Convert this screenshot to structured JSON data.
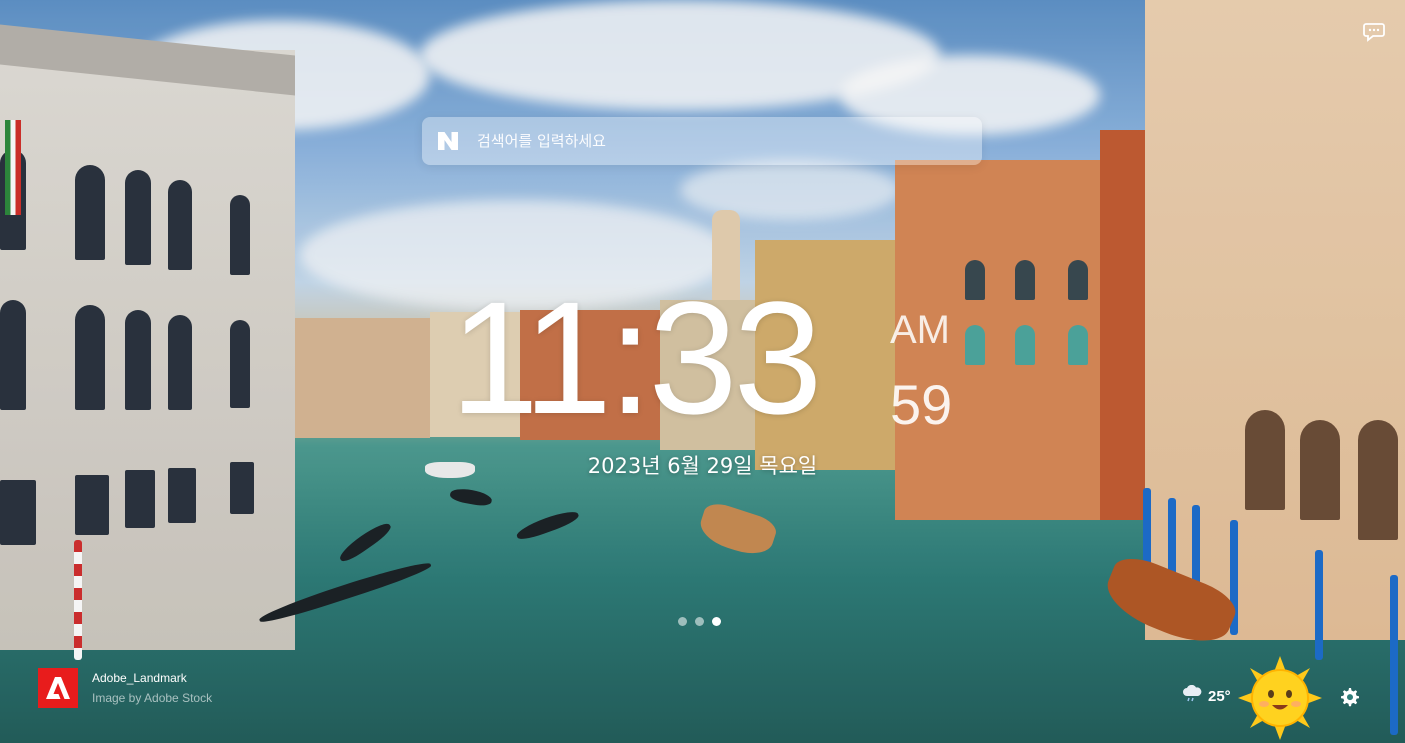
{
  "search": {
    "logo": "N",
    "placeholder": "검색어를 입력하세요"
  },
  "clock": {
    "time": "11:33",
    "ampm": "AM",
    "seconds": "59",
    "date": "2023년 6월 29일 목요일"
  },
  "carousel": {
    "dots": 3,
    "active_index": 2
  },
  "credit": {
    "name": "Adobe_Landmark",
    "source": "Image by Adobe Stock"
  },
  "weather": {
    "temperature": "25°",
    "icon": "cloud-rain-icon"
  },
  "icons": {
    "top_right": "chat-bubble-icon",
    "bottom_right": "gear-icon"
  },
  "colors": {
    "adobe_red": "#e81c1c",
    "water": "#2e7d79",
    "sky": "#6d9fd3"
  }
}
